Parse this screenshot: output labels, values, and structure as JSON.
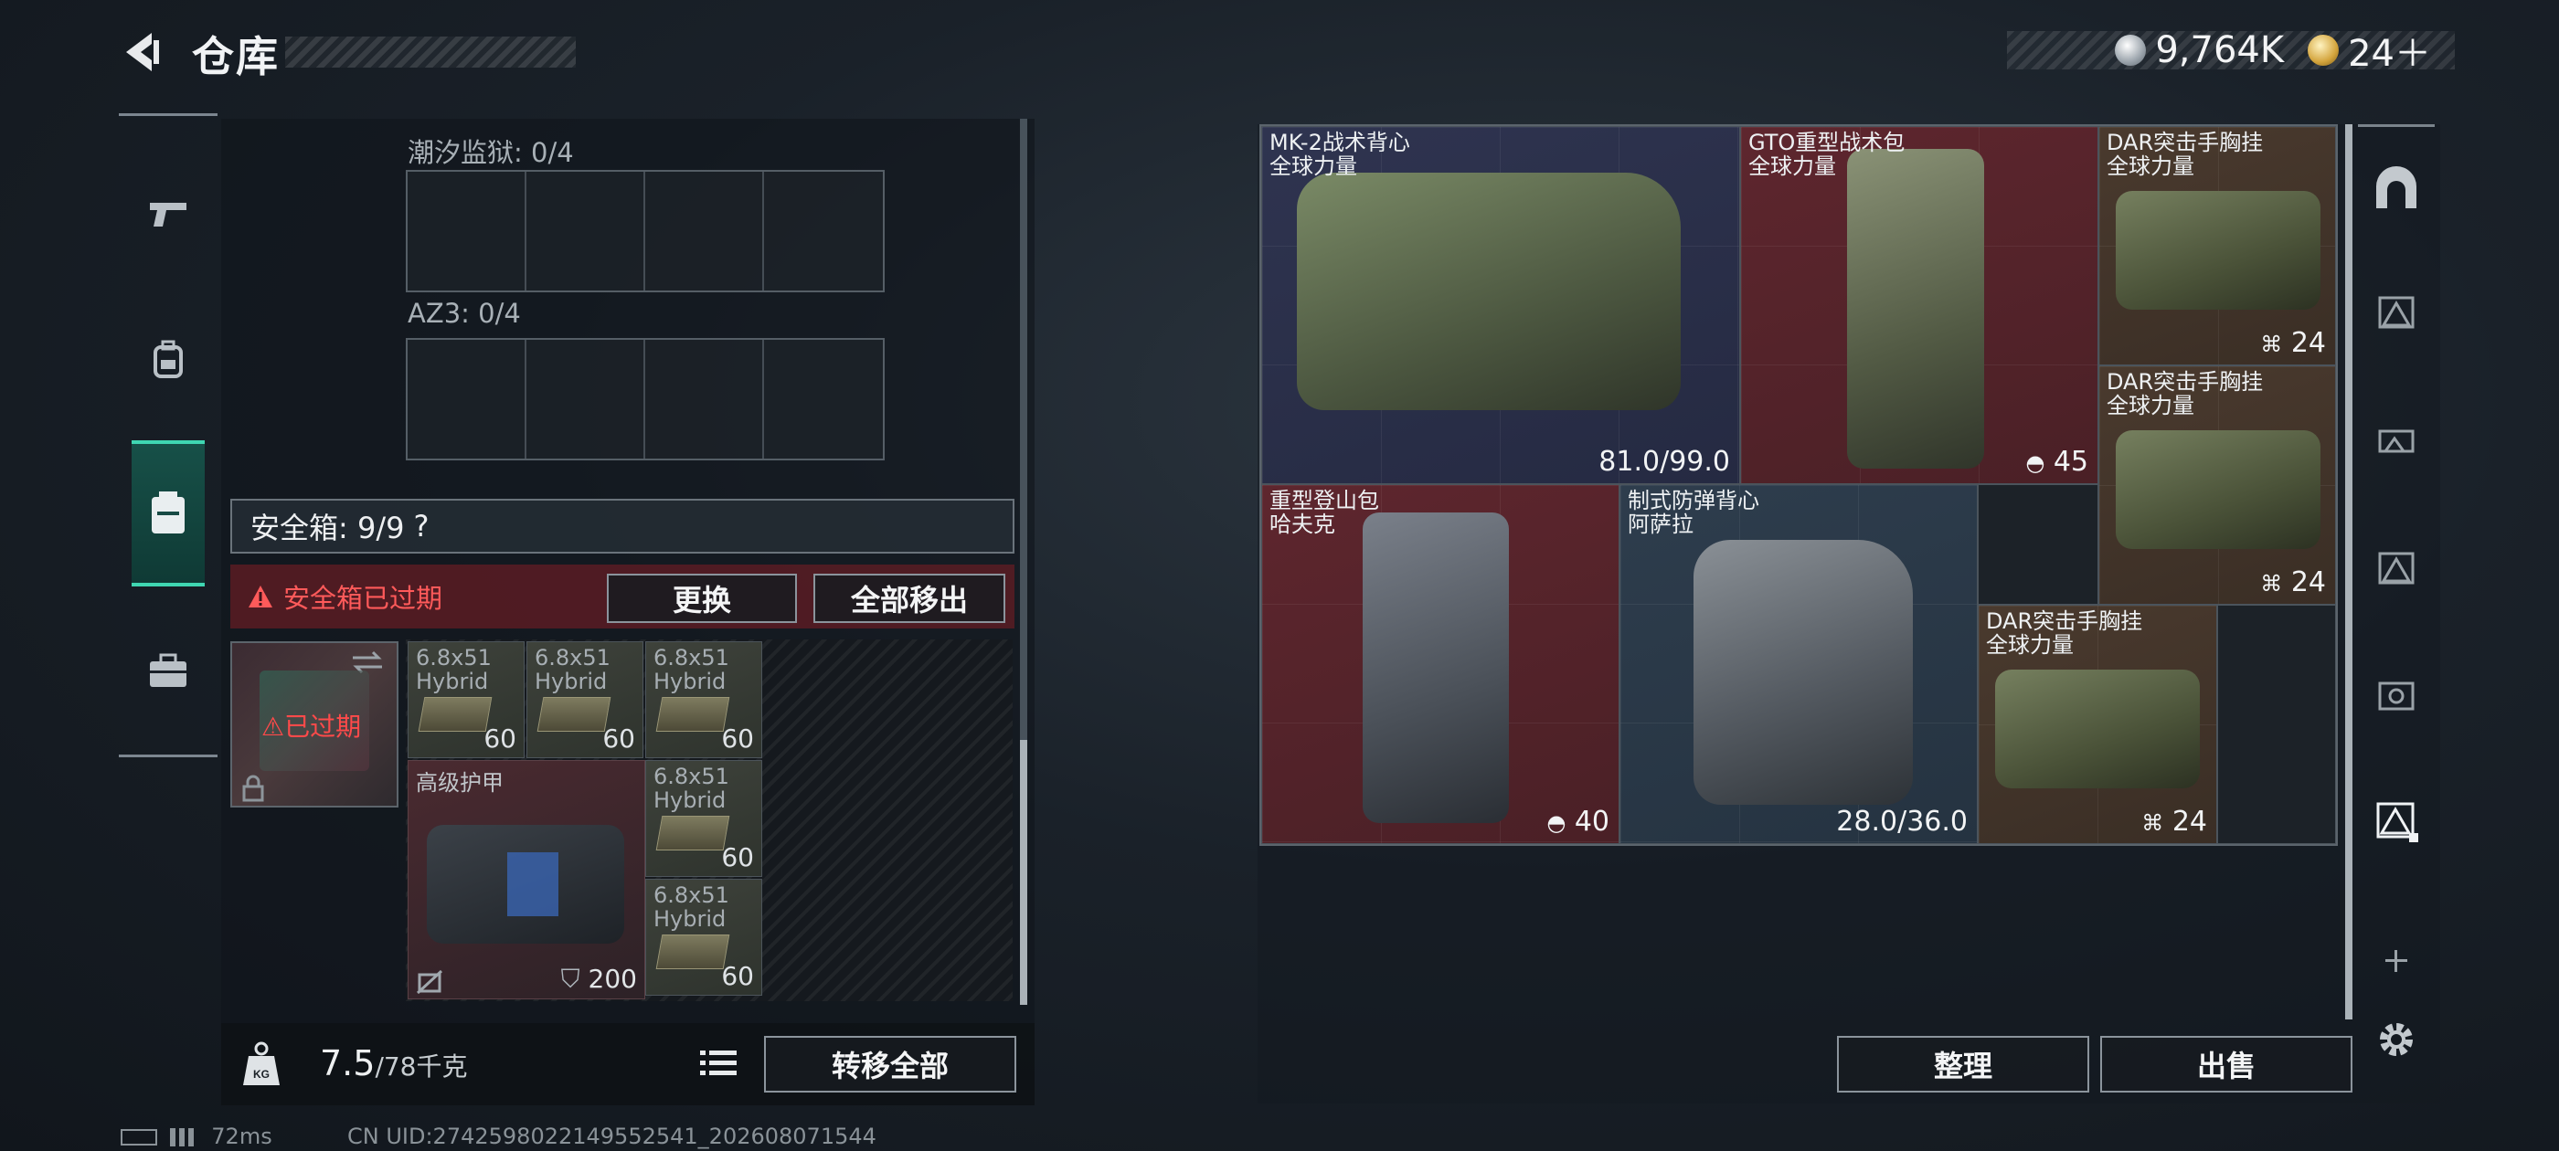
{
  "header": {
    "title": "仓库",
    "currency": {
      "silver": "9,764K",
      "gold": "24＋"
    }
  },
  "left": {
    "slots": [
      {
        "label": "潮汐监狱: 0/4"
      },
      {
        "label": "AZ3: 0/4"
      }
    ],
    "safebox_label": "安全箱: 9/9",
    "help": "?",
    "expired_msg": "安全箱已过期",
    "replace_btn": "更换",
    "move_all_btn": "全部移出",
    "case_status": "已过期",
    "ammo": [
      {
        "name": "6.8x51\nHybrid",
        "qty": "60"
      },
      {
        "name": "6.8x51\nHybrid",
        "qty": "60"
      },
      {
        "name": "6.8x51\nHybrid",
        "qty": "60"
      },
      {
        "name": "6.8x51\nHybrid",
        "qty": "60"
      },
      {
        "name": "6.8x51\nHybrid",
        "qty": "60"
      }
    ],
    "armor": {
      "name": "高级护甲",
      "qty": "200"
    },
    "weight": {
      "current": "7.5",
      "max": "/78千克"
    },
    "transfer_btn": "转移全部"
  },
  "status": {
    "ping": "72ms",
    "uid": "CN UID:2742598022149552541_202608071544"
  },
  "stash": {
    "items": [
      {
        "line1": "MK-2战术背心",
        "line2": "全球力量",
        "value": "81.0/99.0"
      },
      {
        "line1": "GTO重型战术包",
        "line2": "全球力量",
        "value": "45"
      },
      {
        "line1": "DAR突击手胸挂",
        "line2": "全球力量",
        "value": "24"
      },
      {
        "line1": "DAR突击手胸挂",
        "line2": "全球力量",
        "value": "24"
      },
      {
        "line1": "重型登山包",
        "line2": "哈夫克",
        "value": "40"
      },
      {
        "line1": "制式防弹背心",
        "line2": "阿萨拉",
        "value": "28.0/36.0"
      },
      {
        "line1": "DAR突击手胸挂",
        "line2": "全球力量",
        "value": "24"
      }
    ],
    "sort_btn": "整理",
    "sell_btn": "出售",
    "side_icons": [
      "safehouse-icon",
      "collection-icon-ii",
      "collection-icon-iii",
      "collection-icon-iii-b",
      "collection-icon-iv",
      "collection-icon-active",
      "add-icon",
      "settings-icon"
    ]
  },
  "colors": {
    "accent": "#3fd7b2",
    "expired_red": "#ff5a5a",
    "item_red": "#5e262e",
    "item_blue": "#2f3450",
    "item_brown": "#4a3a2e",
    "item_slate": "#2e3d4d"
  }
}
